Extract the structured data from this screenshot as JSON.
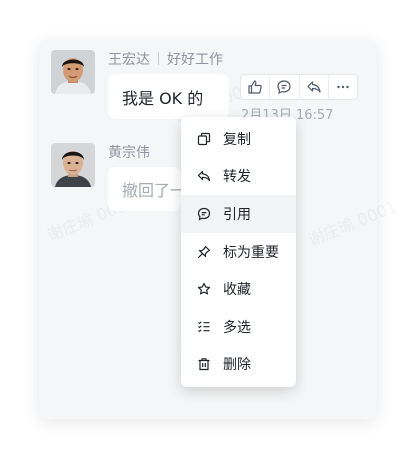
{
  "watermark": "谢庄瑜 0001",
  "messages": [
    {
      "sender": "王宏达",
      "sender_status": "好好工作",
      "text": "我是 OK 的",
      "timestamp": "2月13日 16:57",
      "avatar_icon": "male-avatar"
    },
    {
      "sender": "黄宗伟",
      "text": "撤回了一条消息",
      "avatar_icon": "male-avatar"
    }
  ],
  "reaction_bar": {
    "buttons": [
      "thumbs-up-icon",
      "reply-bubble-icon",
      "forward-icon",
      "more-icon"
    ]
  },
  "context_menu": {
    "items": [
      {
        "label": "复制",
        "icon": "copy-icon"
      },
      {
        "label": "转发",
        "icon": "forward-icon"
      },
      {
        "label": "引用",
        "icon": "quote-icon"
      },
      {
        "label": "标为重要",
        "icon": "pin-icon"
      },
      {
        "label": "收藏",
        "icon": "star-icon"
      },
      {
        "label": "多选",
        "icon": "multi-select-icon"
      },
      {
        "label": "删除",
        "icon": "trash-icon"
      }
    ],
    "active_index": 2
  },
  "colors": {
    "panel_bg": "#f5f6f7",
    "bubble_bg": "#ffffff",
    "muted_text": "#8f959e",
    "menu_hover": "#f2f3f5"
  }
}
